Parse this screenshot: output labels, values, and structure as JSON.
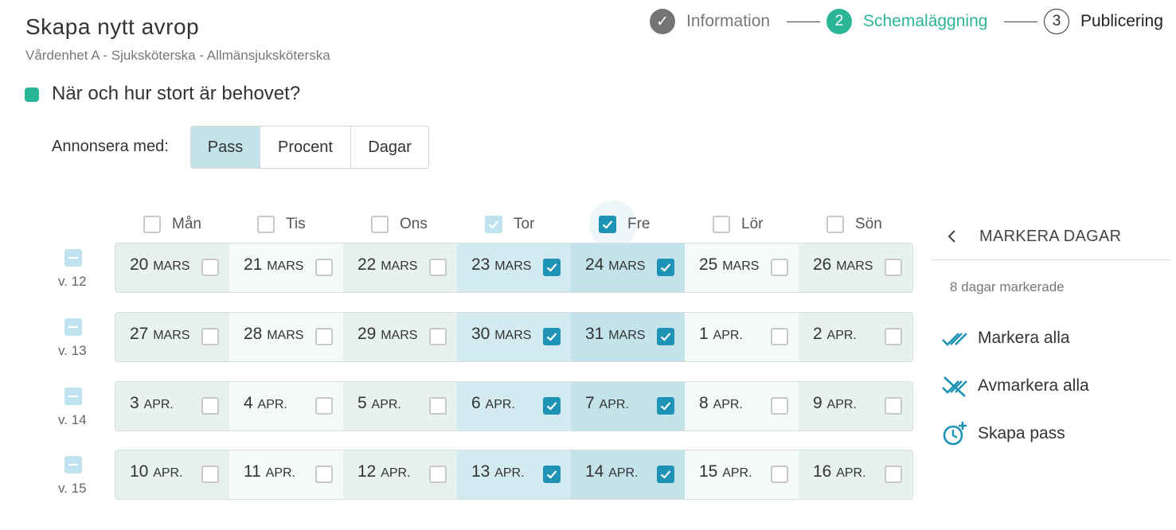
{
  "header": {
    "title": "Skapa nytt avrop",
    "subtitle": "Vårdenhet A - Sjuksköterska - Allmänsjuksköterska"
  },
  "stepper": [
    {
      "marker": "✓",
      "label": "Information",
      "state": "done"
    },
    {
      "marker": "2",
      "label": "Schemaläggning",
      "state": "active"
    },
    {
      "marker": "3",
      "label": "Publicering",
      "state": "upcoming"
    }
  ],
  "section": {
    "heading": "När och hur stort är behovet?"
  },
  "announce": {
    "label": "Annonsera med:",
    "options": [
      "Pass",
      "Procent",
      "Dagar"
    ],
    "selected": "Pass"
  },
  "weekdays": [
    {
      "label": "Mån",
      "checked": false
    },
    {
      "label": "Tis",
      "checked": false
    },
    {
      "label": "Ons",
      "checked": false
    },
    {
      "label": "Tor",
      "checked": true
    },
    {
      "label": "Fre",
      "checked": true
    },
    {
      "label": "Lör",
      "checked": false
    },
    {
      "label": "Sön",
      "checked": false
    }
  ],
  "weeks": [
    {
      "label": "v. 12",
      "days": [
        {
          "num": "20",
          "month": "MARS",
          "checked": false
        },
        {
          "num": "21",
          "month": "MARS",
          "checked": false
        },
        {
          "num": "22",
          "month": "MARS",
          "checked": false
        },
        {
          "num": "23",
          "month": "MARS",
          "checked": true
        },
        {
          "num": "24",
          "month": "MARS",
          "checked": true
        },
        {
          "num": "25",
          "month": "MARS",
          "checked": false
        },
        {
          "num": "26",
          "month": "MARS",
          "checked": false
        }
      ]
    },
    {
      "label": "v. 13",
      "days": [
        {
          "num": "27",
          "month": "MARS",
          "checked": false
        },
        {
          "num": "28",
          "month": "MARS",
          "checked": false
        },
        {
          "num": "29",
          "month": "MARS",
          "checked": false
        },
        {
          "num": "30",
          "month": "MARS",
          "checked": true
        },
        {
          "num": "31",
          "month": "MARS",
          "checked": true
        },
        {
          "num": "1",
          "month": "APR.",
          "checked": false
        },
        {
          "num": "2",
          "month": "APR.",
          "checked": false
        }
      ]
    },
    {
      "label": "v. 14",
      "days": [
        {
          "num": "3",
          "month": "APR.",
          "checked": false
        },
        {
          "num": "4",
          "month": "APR.",
          "checked": false
        },
        {
          "num": "5",
          "month": "APR.",
          "checked": false
        },
        {
          "num": "6",
          "month": "APR.",
          "checked": true
        },
        {
          "num": "7",
          "month": "APR.",
          "checked": true
        },
        {
          "num": "8",
          "month": "APR.",
          "checked": false
        },
        {
          "num": "9",
          "month": "APR.",
          "checked": false
        }
      ]
    },
    {
      "label": "v. 15",
      "days": [
        {
          "num": "10",
          "month": "APR.",
          "checked": false
        },
        {
          "num": "11",
          "month": "APR.",
          "checked": false
        },
        {
          "num": "12",
          "month": "APR.",
          "checked": false
        },
        {
          "num": "13",
          "month": "APR.",
          "checked": true
        },
        {
          "num": "14",
          "month": "APR.",
          "checked": true
        },
        {
          "num": "15",
          "month": "APR.",
          "checked": false
        },
        {
          "num": "16",
          "month": "APR.",
          "checked": false
        }
      ]
    }
  ],
  "side_panel": {
    "title": "MARKERA DAGAR",
    "count_text": "8 dagar markerade",
    "actions": [
      {
        "label": "Markera alla",
        "icon": "double-check-icon"
      },
      {
        "label": "Avmarkera alla",
        "icon": "uncheck-all-icon"
      },
      {
        "label": "Skapa pass",
        "icon": "clock-plus-icon"
      }
    ]
  },
  "colors": {
    "accent_green": "#2bb597",
    "accent_blue": "#1e93b5",
    "selected_bg": "#c3e2ea"
  }
}
